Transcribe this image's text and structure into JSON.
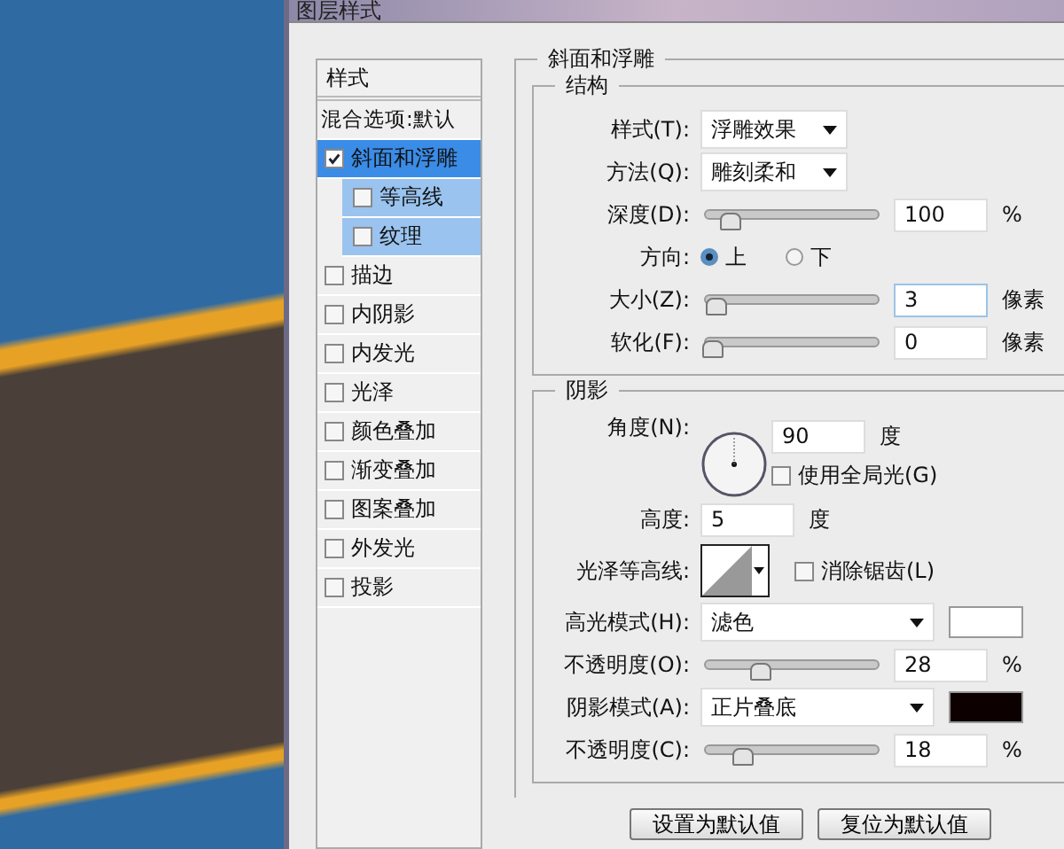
{
  "window": {
    "title": "图层样式"
  },
  "sidebar": {
    "header": "样式",
    "items": [
      {
        "label": "混合选项:默认",
        "kind": "plain",
        "selected": false
      },
      {
        "label": "斜面和浮雕",
        "kind": "checkbox",
        "checked": true,
        "selected": true,
        "children": [
          {
            "label": "等高线",
            "checked": false,
            "selected": false
          },
          {
            "label": "纹理",
            "checked": false,
            "selected": false
          }
        ]
      },
      {
        "label": "描边",
        "kind": "checkbox",
        "checked": false,
        "selected": false
      },
      {
        "label": "内阴影",
        "kind": "checkbox",
        "checked": false,
        "selected": false
      },
      {
        "label": "内发光",
        "kind": "checkbox",
        "checked": false,
        "selected": false
      },
      {
        "label": "光泽",
        "kind": "checkbox",
        "checked": false,
        "selected": false
      },
      {
        "label": "颜色叠加",
        "kind": "checkbox",
        "checked": false,
        "selected": false
      },
      {
        "label": "渐变叠加",
        "kind": "checkbox",
        "checked": false,
        "selected": false
      },
      {
        "label": "图案叠加",
        "kind": "checkbox",
        "checked": false,
        "selected": false
      },
      {
        "label": "外发光",
        "kind": "checkbox",
        "checked": false,
        "selected": false
      },
      {
        "label": "投影",
        "kind": "checkbox",
        "checked": false,
        "selected": false
      }
    ]
  },
  "panel": {
    "title": "斜面和浮雕",
    "structure": {
      "title": "结构",
      "rows": [
        {
          "kind": "dropdown",
          "label": "样式(T):",
          "value": "浮雕效果"
        },
        {
          "kind": "dropdown",
          "label": "方法(Q):",
          "value": "雕刻柔和"
        },
        {
          "kind": "slider",
          "label": "深度(D):",
          "level": 0.1,
          "value": "100",
          "unit": "%"
        },
        {
          "kind": "radio",
          "label": "方向:",
          "options": [
            {
              "label": "上",
              "selected": true
            },
            {
              "label": "下",
              "selected": false
            }
          ]
        },
        {
          "kind": "slider",
          "label": "大小(Z):",
          "level": 0.02,
          "value": "3",
          "unit": "像素",
          "focused": true
        },
        {
          "kind": "slider",
          "label": "软化(F):",
          "level": 0,
          "value": "0",
          "unit": "像素"
        }
      ]
    },
    "shading": {
      "title": "阴影",
      "rows": [
        {
          "kind": "angle",
          "label": "角度(N):",
          "value": "90",
          "unit": "度",
          "checkbox": {
            "label": "使用全局光(G)",
            "checked": false
          }
        },
        {
          "kind": "altitude",
          "label": "高度:",
          "value": "5",
          "unit": "度"
        },
        {
          "kind": "contour",
          "label": "光泽等高线:",
          "checkbox": {
            "label": "消除锯齿(L)",
            "checked": false
          }
        },
        {
          "kind": "mode",
          "label": "高光模式(H):",
          "value": "滤色",
          "color": "#ffffff"
        },
        {
          "kind": "slider",
          "label": "不透明度(O):",
          "level": 0.28,
          "value": "28",
          "unit": "%"
        },
        {
          "kind": "mode",
          "label": "阴影模式(A):",
          "value": "正片叠底",
          "color": "#0d0000"
        },
        {
          "kind": "slider",
          "label": "不透明度(C):",
          "level": 0.18,
          "value": "18",
          "unit": "%"
        }
      ]
    }
  },
  "buttons": [
    {
      "label": "设置为默认值"
    },
    {
      "label": "复位为默认值"
    }
  ]
}
